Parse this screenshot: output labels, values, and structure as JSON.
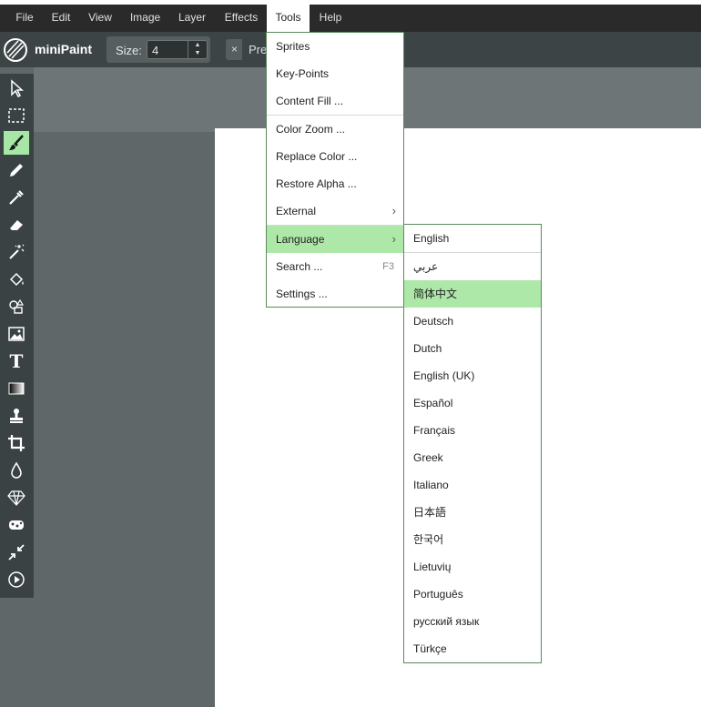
{
  "app": {
    "name": "miniPaint"
  },
  "menubar": [
    {
      "label": "File"
    },
    {
      "label": "Edit"
    },
    {
      "label": "View"
    },
    {
      "label": "Image"
    },
    {
      "label": "Layer"
    },
    {
      "label": "Effects"
    },
    {
      "label": "Tools"
    },
    {
      "label": "Help"
    }
  ],
  "toolbar": {
    "size_label": "Size:",
    "size_value": "4",
    "spin_up": "▲",
    "spin_down": "▼",
    "close_glyph": "×",
    "preset_label": "Pre"
  },
  "tools": [
    {
      "name": "select-icon"
    },
    {
      "name": "selection-rect-icon"
    },
    {
      "name": "brush-icon",
      "active": true
    },
    {
      "name": "pencil-icon"
    },
    {
      "name": "color-picker-icon"
    },
    {
      "name": "eraser-icon"
    },
    {
      "name": "magic-wand-icon"
    },
    {
      "name": "fill-bucket-icon"
    },
    {
      "name": "shapes-icon"
    },
    {
      "name": "image-icon"
    },
    {
      "name": "text-icon"
    },
    {
      "name": "gradient-icon"
    },
    {
      "name": "clone-stamp-icon"
    },
    {
      "name": "crop-icon"
    },
    {
      "name": "blur-drop-icon"
    },
    {
      "name": "sharpen-icon"
    },
    {
      "name": "bulge-icon"
    },
    {
      "name": "shrink-icon"
    },
    {
      "name": "animation-play-icon"
    }
  ],
  "text_tool_glyph": "T",
  "tools_menu": {
    "items": [
      {
        "label": "Sprites"
      },
      {
        "label": "Key-Points"
      },
      {
        "label": "Content Fill ..."
      },
      {
        "label": "Color Zoom ..."
      },
      {
        "label": "Replace Color ..."
      },
      {
        "label": "Restore Alpha ..."
      },
      {
        "label": "External",
        "arrow": "›"
      },
      {
        "label": "Language",
        "arrow": "›",
        "highlighted": true
      },
      {
        "label": "Search ...",
        "shortcut": "F3"
      },
      {
        "label": "Settings ..."
      }
    ]
  },
  "language_menu": {
    "items": [
      {
        "label": "English"
      },
      {
        "label": "عربي"
      },
      {
        "label": "简体中文",
        "highlighted": true
      },
      {
        "label": "Deutsch"
      },
      {
        "label": "Dutch"
      },
      {
        "label": "English (UK)"
      },
      {
        "label": "Español"
      },
      {
        "label": "Français"
      },
      {
        "label": "Greek"
      },
      {
        "label": "Italiano"
      },
      {
        "label": "日本語"
      },
      {
        "label": "한국어"
      },
      {
        "label": "Lietuvių"
      },
      {
        "label": "Português"
      },
      {
        "label": "русский язык"
      },
      {
        "label": "Türkçe"
      }
    ]
  },
  "colors": {
    "highlight": "#aee8a8",
    "active_tool": "#a6e7a6",
    "menubar": "#2a2a2a",
    "toolbar": "#3d4445"
  }
}
